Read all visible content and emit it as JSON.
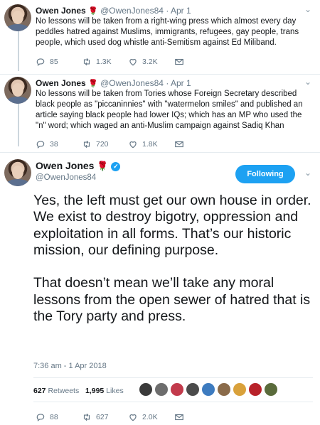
{
  "tweets": [
    {
      "name": "Owen Jones",
      "rose": "🌹",
      "handle": "@OwenJones84",
      "date": "Apr 1",
      "text": "No lessons will be taken from a right-wing press which almost every day peddles hatred against Muslims, immigrants, refugees, gay people, trans people, which used dog whistle anti-Semitism against Ed Miliband.",
      "replies": "85",
      "retweets": "1.3K",
      "likes": "3.2K"
    },
    {
      "name": "Owen Jones",
      "rose": "🌹",
      "handle": "@OwenJones84",
      "date": "Apr 1",
      "text": "No lessons will be taken from Tories whose Foreign Secretary described black people as \"piccaninnies\" with \"watermelon smiles\" and published an article saying black people had lower IQs; which has an MP who used the \"n\" word; which waged an anti-Muslim campaign against Sadiq Khan",
      "replies": "38",
      "retweets": "720",
      "likes": "1.8K"
    }
  ],
  "main": {
    "name": "Owen Jones",
    "rose": "🌹",
    "verified": "✓",
    "handle": "@OwenJones84",
    "follow_label": "Following",
    "text": "Yes, the left must get our own house in order. We exist to destroy bigotry, oppression and exploitation in all forms. That’s our historic mission, our defining purpose.\n\nThat doesn’t mean we’ll take any moral lessons from the open sewer of hatred that is the Tory party and press.",
    "timestamp": "7:36 am - 1 Apr 2018",
    "retweet_count": "627",
    "retweet_label": "Retweets",
    "like_count": "1,995",
    "like_label": "Likes",
    "replies": "88",
    "retweets": "627",
    "likes": "2.0K"
  },
  "colors": {
    "accent": "#1da1f2",
    "text": "#14171a",
    "muted": "#657786",
    "rose": "#c2131b"
  },
  "icons": [
    "reply-icon",
    "retweet-icon",
    "like-icon",
    "message-icon",
    "chevron-down-icon",
    "verified-icon",
    "rose-icon"
  ]
}
